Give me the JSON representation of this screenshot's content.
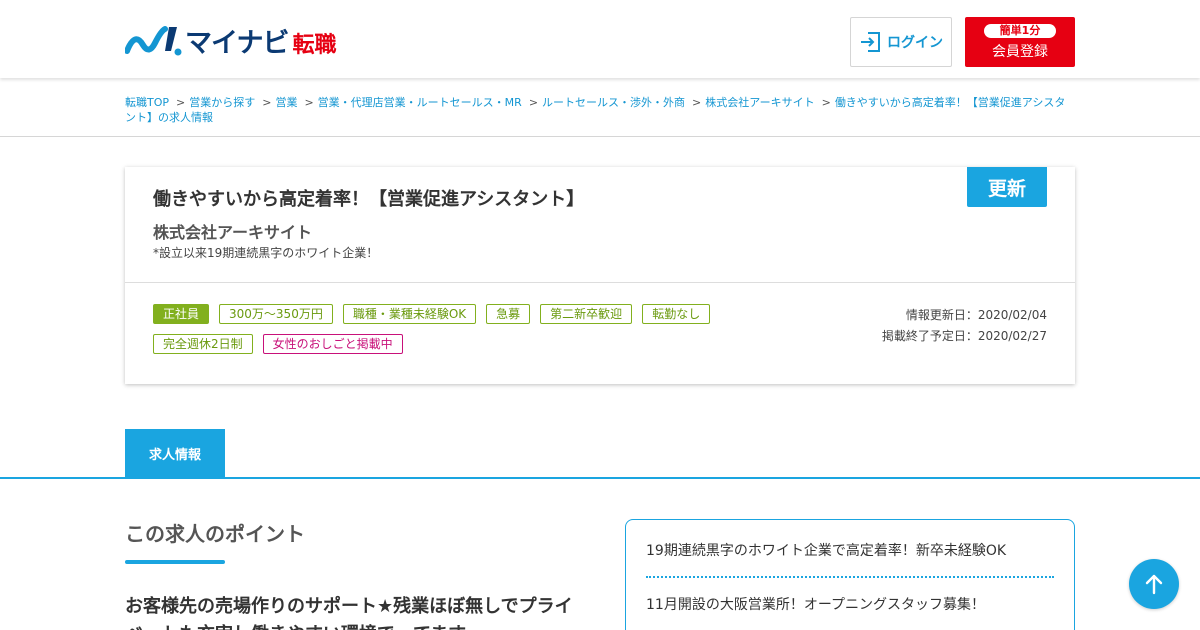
{
  "header": {
    "logo_text": "マイナビ",
    "logo_sub": "転職",
    "login_label": "ログイン",
    "register_badge": "簡単1分",
    "register_label": "会員登録"
  },
  "breadcrumb": {
    "items": [
      "転職TOP",
      "営業から探す",
      "営業",
      "営業・代理店営業・ルートセールス・MR",
      "ルートセールス・渉外・外商",
      "株式会社アーキサイト",
      "働きやすいから高定着率！【営業促進アシスタント】の求人情報"
    ],
    "separator": ">"
  },
  "job": {
    "title": "働きやすいから高定着率！【営業促進アシスタント】",
    "company": "株式会社アーキサイト",
    "catch": "*設立以来19期連続黒字のホワイト企業！",
    "badge": "更新",
    "tags_row1": [
      "正社員",
      "300万～350万円",
      "職種・業種未経験OK",
      "急募",
      "第二新卒歓迎",
      "転勤なし"
    ],
    "tags_row2": [
      "完全週休2日制",
      "女性のおしごと掲載中"
    ],
    "updated": "情報更新日：2020/02/04",
    "end_date": "掲載終了予定日：2020/02/27"
  },
  "tabs": {
    "active_label": "求人情報"
  },
  "content": {
    "point_heading": "この求人のポイント",
    "point_lead": "お客様先の売場作りのサポート★残業ほぼ無しでプライベートも充実し働きやすい環境で…てます",
    "points": [
      "19期連続黒字のホワイト企業で高定着率！新卒未経験OK",
      "11月開設の大阪営業所！オープニングスタッフ募集！"
    ]
  },
  "colors": {
    "accent": "#1aa5e0",
    "brand_red": "#e60012",
    "tag_green": "#82b01e",
    "tag_pink": "#c8117a"
  }
}
